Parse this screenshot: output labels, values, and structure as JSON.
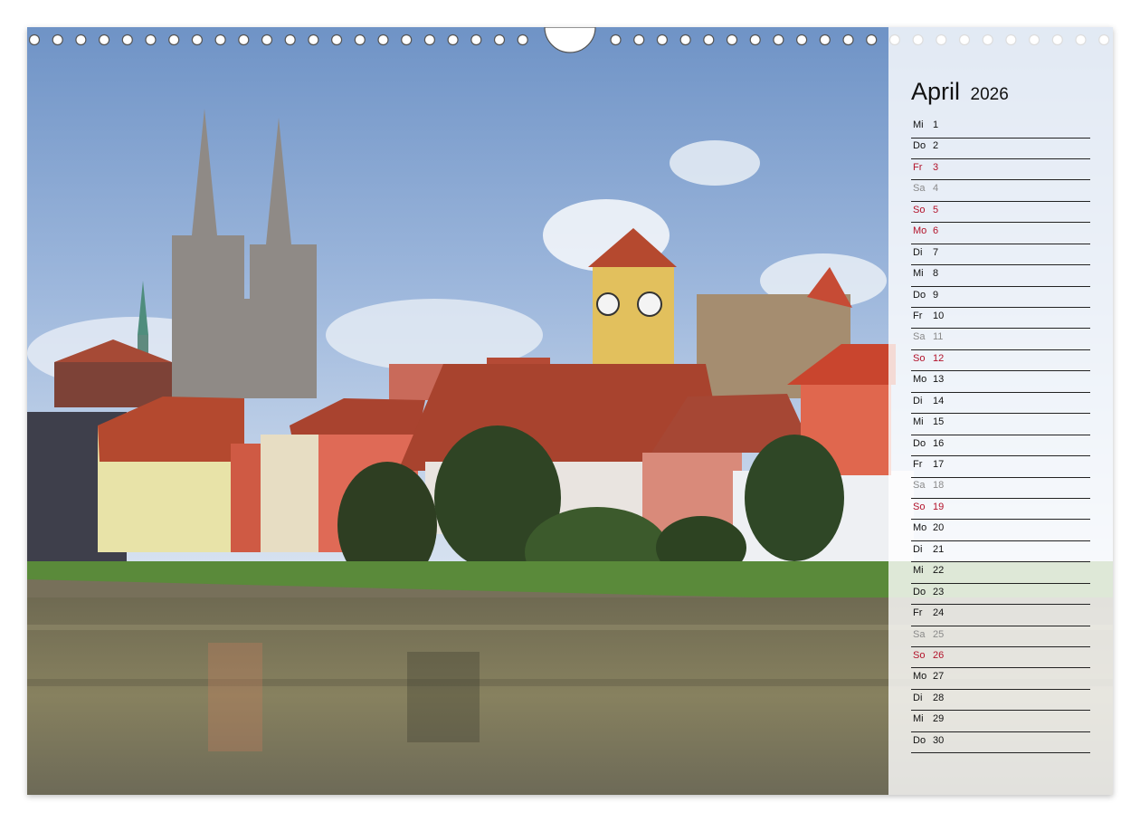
{
  "calendar": {
    "month": "April",
    "year": "2026",
    "days": [
      {
        "weekday": "Mi",
        "day": "1",
        "type": "normal"
      },
      {
        "weekday": "Do",
        "day": "2",
        "type": "normal"
      },
      {
        "weekday": "Fr",
        "day": "3",
        "type": "holiday"
      },
      {
        "weekday": "Sa",
        "day": "4",
        "type": "saturday"
      },
      {
        "weekday": "So",
        "day": "5",
        "type": "holiday"
      },
      {
        "weekday": "Mo",
        "day": "6",
        "type": "holiday"
      },
      {
        "weekday": "Di",
        "day": "7",
        "type": "normal"
      },
      {
        "weekday": "Mi",
        "day": "8",
        "type": "normal"
      },
      {
        "weekday": "Do",
        "day": "9",
        "type": "normal"
      },
      {
        "weekday": "Fr",
        "day": "10",
        "type": "normal"
      },
      {
        "weekday": "Sa",
        "day": "11",
        "type": "saturday"
      },
      {
        "weekday": "So",
        "day": "12",
        "type": "holiday"
      },
      {
        "weekday": "Mo",
        "day": "13",
        "type": "normal"
      },
      {
        "weekday": "Di",
        "day": "14",
        "type": "normal"
      },
      {
        "weekday": "Mi",
        "day": "15",
        "type": "normal"
      },
      {
        "weekday": "Do",
        "day": "16",
        "type": "normal"
      },
      {
        "weekday": "Fr",
        "day": "17",
        "type": "normal"
      },
      {
        "weekday": "Sa",
        "day": "18",
        "type": "saturday"
      },
      {
        "weekday": "So",
        "day": "19",
        "type": "holiday"
      },
      {
        "weekday": "Mo",
        "day": "20",
        "type": "normal"
      },
      {
        "weekday": "Di",
        "day": "21",
        "type": "normal"
      },
      {
        "weekday": "Mi",
        "day": "22",
        "type": "normal"
      },
      {
        "weekday": "Do",
        "day": "23",
        "type": "normal"
      },
      {
        "weekday": "Fr",
        "day": "24",
        "type": "normal"
      },
      {
        "weekday": "Sa",
        "day": "25",
        "type": "saturday"
      },
      {
        "weekday": "So",
        "day": "26",
        "type": "holiday"
      },
      {
        "weekday": "Mo",
        "day": "27",
        "type": "normal"
      },
      {
        "weekday": "Di",
        "day": "28",
        "type": "normal"
      },
      {
        "weekday": "Mi",
        "day": "29",
        "type": "normal"
      },
      {
        "weekday": "Do",
        "day": "30",
        "type": "normal"
      }
    ]
  },
  "colors": {
    "holiday": "#b3122a",
    "saturday": "#8a8a8a",
    "normal": "#111111"
  },
  "photo": {
    "subject": "Regensburg old town skyline on the Danube"
  }
}
